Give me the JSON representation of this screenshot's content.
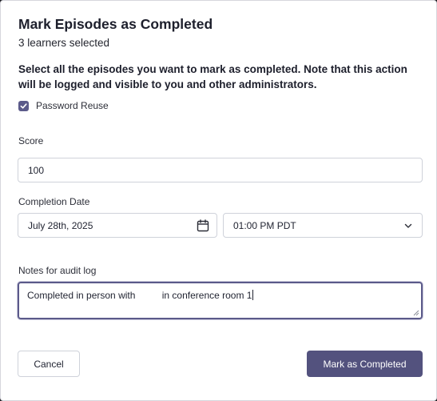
{
  "dialog": {
    "title": "Mark Episodes as Completed",
    "subtitle": "3 learners selected",
    "description": "Select all the episodes you want to mark as completed. Note that this action will be logged and visible to you and other administrators.",
    "episodes": [
      {
        "label": "Password Reuse",
        "checked": true
      }
    ],
    "score": {
      "label": "Score",
      "value": "100"
    },
    "completion": {
      "label": "Completion Date",
      "date_value": "July 28th, 2025",
      "date_icon": "calendar-icon",
      "time_value": "01:00 PM PDT",
      "time_icon": "chevron-down-icon"
    },
    "notes": {
      "label": "Notes for audit log",
      "value": "Completed in person with          in conference room 1"
    },
    "buttons": {
      "cancel": "Cancel",
      "submit": "Mark as Completed"
    }
  },
  "colors": {
    "accent": "#53527e",
    "checkbox": "#5b5a8a",
    "border": "#cfd2da"
  }
}
